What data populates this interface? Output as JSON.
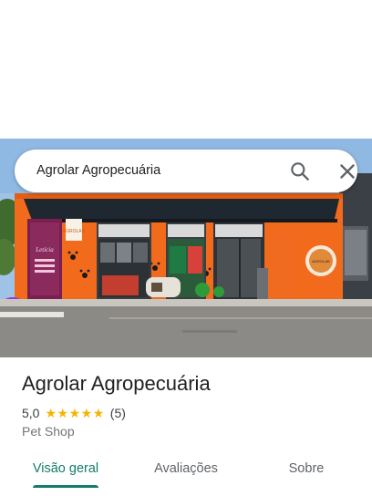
{
  "search": {
    "value": "Agrolar Agropecuária"
  },
  "photo": {
    "alt": "",
    "signage": {
      "left_sign_name": "Letícia",
      "left_sign_lines": [
        "",
        "",
        ""
      ],
      "awning_side_text": "AGROLAR",
      "logo_text": "AGROLAR"
    }
  },
  "place": {
    "title": "Agrolar Agropecuária",
    "rating": "5,0",
    "stars": 5,
    "review_count": "(5)",
    "category": "Pet Shop"
  },
  "tabs": [
    {
      "label": "Visão geral",
      "active": true
    },
    {
      "label": "Avaliações",
      "active": false
    },
    {
      "label": "Sobre",
      "active": false
    }
  ],
  "colors": {
    "accent": "#137c6a",
    "star": "#f4b400",
    "storefront_orange": "#f26a1b",
    "awning": "#1f2730"
  },
  "icons": [
    "search-icon",
    "close-icon",
    "star-icon"
  ]
}
